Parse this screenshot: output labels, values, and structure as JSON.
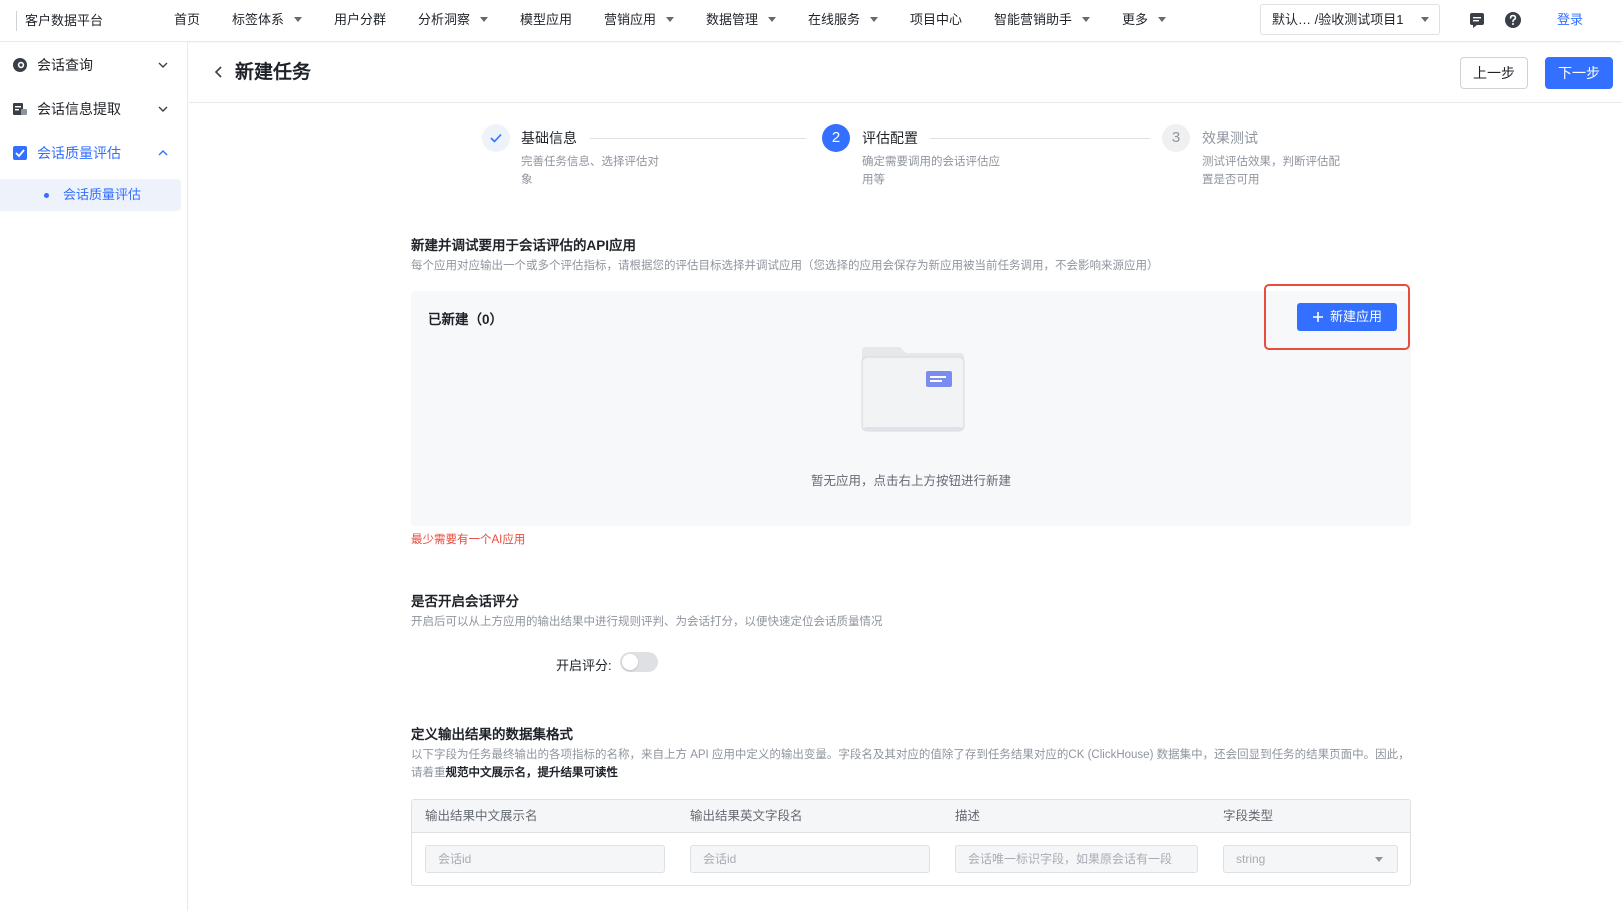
{
  "app": {
    "brand": "客户数据平台"
  },
  "nav": {
    "items": [
      {
        "label": "首页",
        "has_caret": false
      },
      {
        "label": "标签体系",
        "has_caret": true
      },
      {
        "label": "用户分群",
        "has_caret": false
      },
      {
        "label": "分析洞察",
        "has_caret": true
      },
      {
        "label": "模型应用",
        "has_caret": false
      },
      {
        "label": "营销应用",
        "has_caret": true
      },
      {
        "label": "数据管理",
        "has_caret": true
      },
      {
        "label": "在线服务",
        "has_caret": true
      },
      {
        "label": "项目中心",
        "has_caret": false
      },
      {
        "label": "智能营销助手",
        "has_caret": true
      },
      {
        "label": "更多",
        "has_caret": true
      }
    ],
    "project_select": "默认…  /验收测试项目1",
    "icons": [
      "message-icon",
      "help-icon"
    ],
    "login": "登录"
  },
  "sidebar": {
    "groups": [
      {
        "label": "会话查询",
        "icon": "chat-search-icon",
        "expanded": false
      },
      {
        "label": "会话信息提取",
        "icon": "extract-icon",
        "expanded": false
      },
      {
        "label": "会话质量评估",
        "icon": "checkbox-icon",
        "expanded": true
      }
    ],
    "sub_item": "会话质量评估"
  },
  "header": {
    "title": "新建任务",
    "prev_label": "上一步",
    "next_label": "下一步"
  },
  "steps": [
    {
      "index": "1",
      "status": "done",
      "title": "基础信息",
      "desc": "完善任务信息、选择评估对象"
    },
    {
      "index": "2",
      "status": "active",
      "title": "评估配置",
      "desc": "确定需要调用的会话评估应用等"
    },
    {
      "index": "3",
      "status": "pending",
      "title": "效果测试",
      "desc": "测试评估效果，判断评估配置是否可用"
    }
  ],
  "api_section": {
    "title": "新建并调试要用于会话评估的API应用",
    "desc": "每个应用对应输出一个或多个评估指标，请根据您的评估目标选择并调试应用（您选择的应用会保存为新应用被当前任务调用，不会影响来源应用）",
    "count_label": "已新建（0）",
    "new_button": "新建应用",
    "empty_text": "暂无应用，点击右上方按钮进行新建",
    "error": "最少需要有一个AI应用"
  },
  "score_section": {
    "title": "是否开启会话评分",
    "desc": "开启后可以从上方应用的输出结果中进行规则评判、为会话打分，以便快速定位会话质量情况",
    "toggle_label": "开启评分:",
    "enabled": false
  },
  "dataset_section": {
    "title": "定义输出结果的数据集格式",
    "desc_part1": "以下字段为任务最终输出的各项指标的名称，来自上方 API 应用中定义的输出变量。字段名及其对应的值除了存到任务结果对应的CK (ClickHouse) 数据集中，还会回显到任务的结果页面中。因此，请着重",
    "desc_bold": "规范中文展示名，提升结果可读性",
    "columns": [
      "输出结果中文展示名",
      "输出结果英文字段名",
      "描述",
      "字段类型"
    ],
    "row": {
      "cn_name_placeholder": "会话id",
      "en_name_placeholder": "会话id",
      "desc_placeholder": "会话唯一标识字段，如果原会话有一段",
      "type_value": "string"
    }
  },
  "colors": {
    "primary": "#3370ff",
    "error": "#e84c3d",
    "highlight_border": "#e84c3d"
  }
}
